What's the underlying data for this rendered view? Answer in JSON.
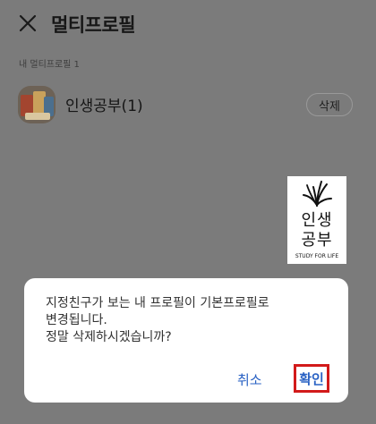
{
  "header": {
    "close_icon": "close-icon",
    "title": "멀티프로필"
  },
  "section": {
    "label": "내 멀티프로필 1"
  },
  "profiles": [
    {
      "name": "인생공부(1)",
      "delete_label": "삭제",
      "avatar_icon": "book-stack-avatar"
    }
  ],
  "logo": {
    "icon": "leaf-icon",
    "line1": "인생",
    "line2": "공부",
    "tagline": "STUDY FOR LIFE"
  },
  "dialog": {
    "lines": [
      "지정친구가 보는 내 프로필이 기본프로필로",
      "변경됩니다.",
      "정말 삭제하시겠습니까?"
    ],
    "cancel_label": "취소",
    "confirm_label": "확인"
  },
  "colors": {
    "overlay_bg": "#7b7b7b",
    "dialog_bg": "#ffffff",
    "button_text": "#2a62c4",
    "highlight_border": "#d21a1a"
  }
}
